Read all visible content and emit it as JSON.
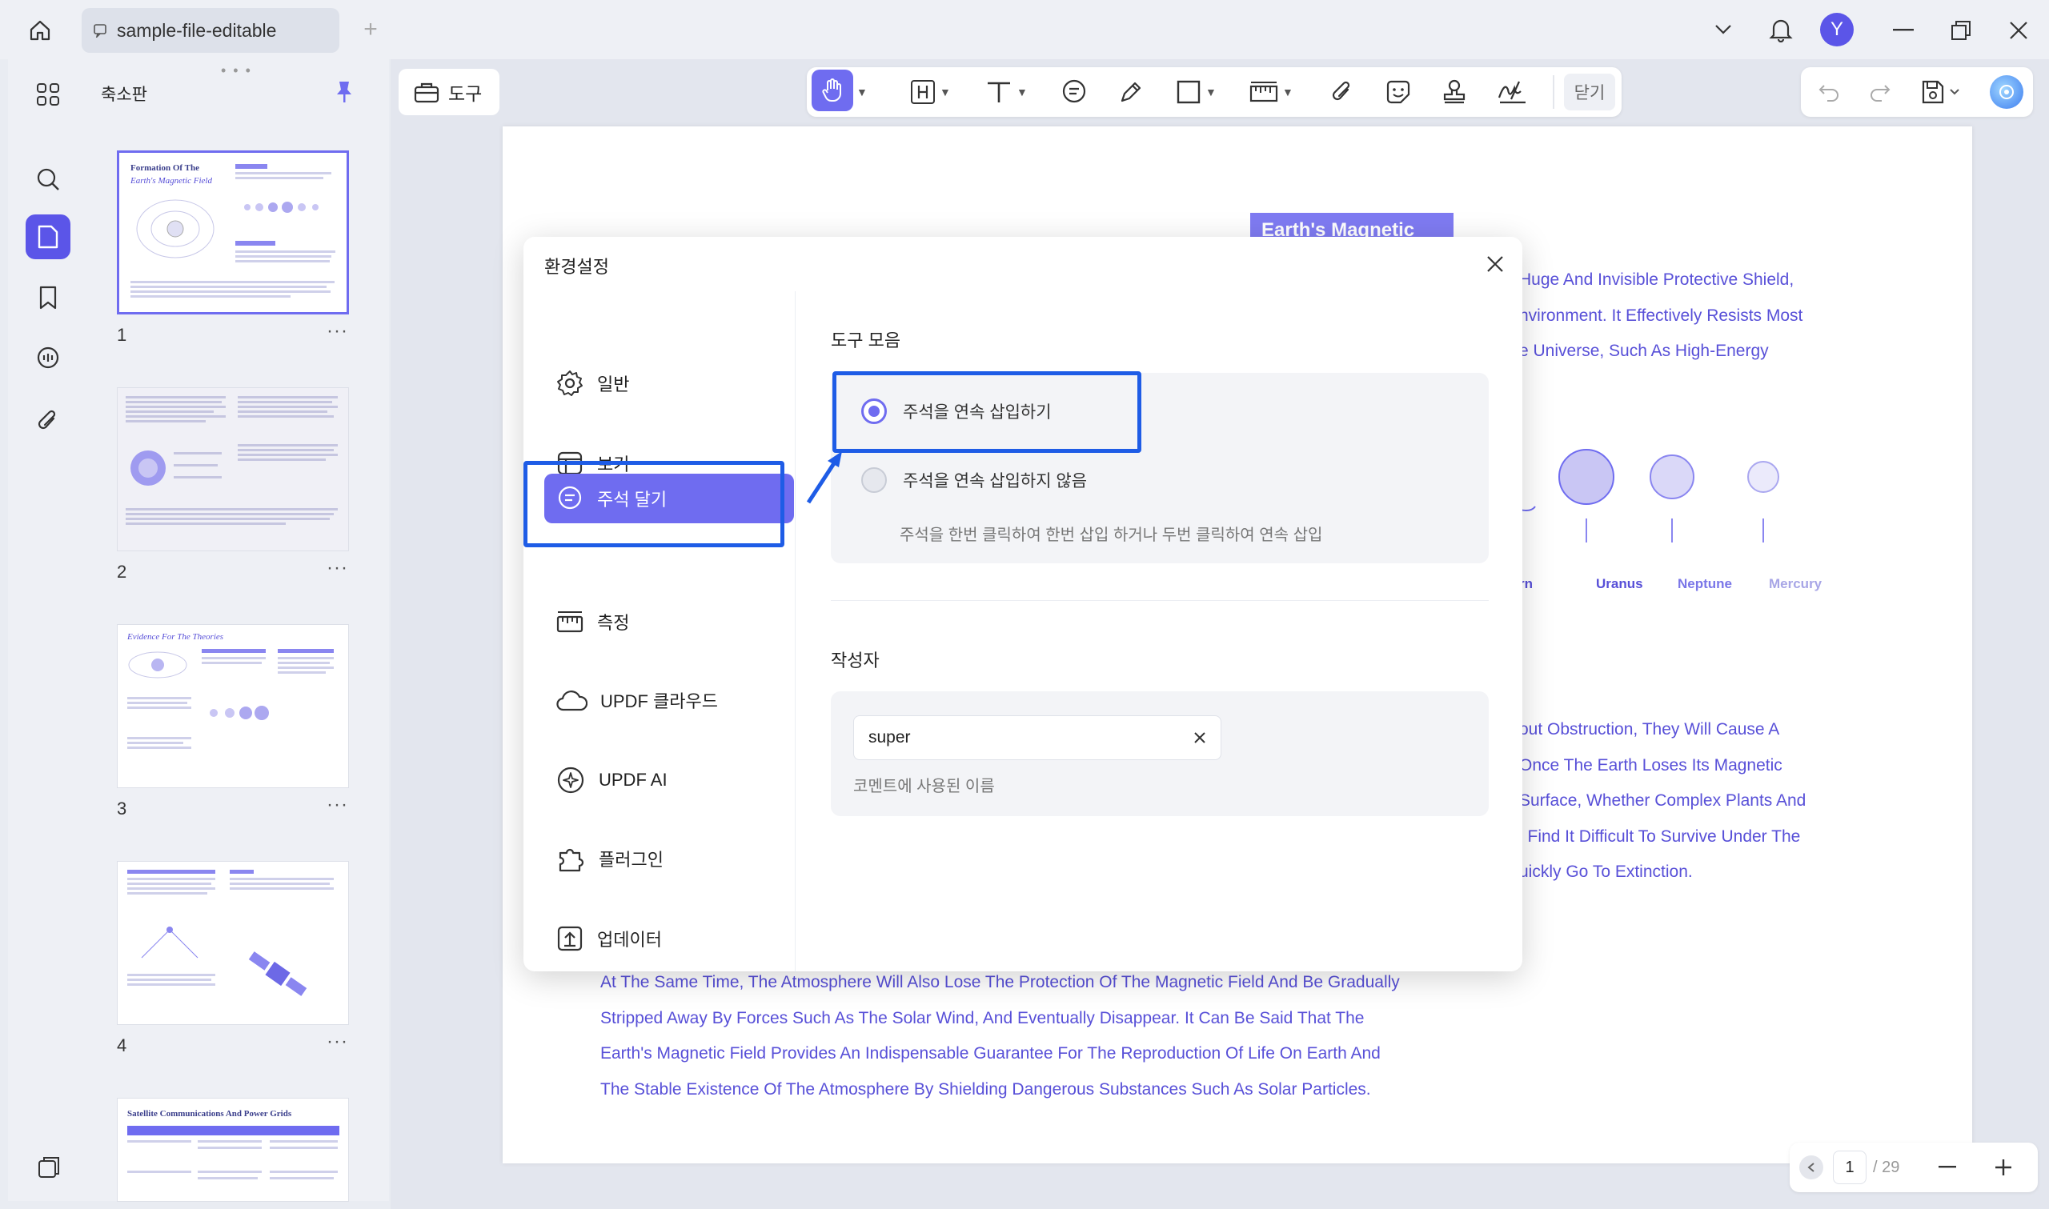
{
  "titlebar": {
    "tab_title": "sample-file-editable",
    "avatar_letter": "Y"
  },
  "sidebar": {
    "title": "축소판",
    "pages": [
      "1",
      "2",
      "3",
      "4"
    ]
  },
  "toolbar": {
    "tools_label": "도구",
    "close_label": "닫기"
  },
  "document": {
    "heading_partial": "Earth's Magnetic",
    "para1": [
      "Huge And Invisible Protective Shield,",
      "nvironment. It Effectively Resists Most",
      "e Universe, Such As High-Energy"
    ],
    "planets": [
      "rn",
      "Uranus",
      "Neptune",
      "Mercury"
    ],
    "para2": [
      "out Obstruction, They Will Cause A",
      "Once The Earth Loses Its Magnetic",
      "Surface, Whether Complex Plants And",
      "l Find It Difficult To Survive Under The",
      "uickly Go To Extinction."
    ],
    "para3": [
      "At The Same Time, The Atmosphere Will Also Lose The Protection Of The Magnetic Field And Be Gradually",
      "Stripped Away By Forces Such As The Solar Wind, And Eventually Disappear. It Can Be Said That The",
      "Earth's Magnetic Field Provides An Indispensable Guarantee For The Reproduction Of Life On Earth And",
      "The Stable Existence Of The Atmosphere By Shielding Dangerous Substances Such As Solar Particles."
    ]
  },
  "page_nav": {
    "current": "1",
    "total": "/ 29"
  },
  "dialog": {
    "title": "환경설정",
    "menu": [
      {
        "label": "일반",
        "icon": "gear-icon"
      },
      {
        "label": "보기",
        "icon": "layout-icon"
      },
      {
        "label": "주석 달기",
        "icon": "comment-icon"
      },
      {
        "label": "측정",
        "icon": "ruler-icon"
      },
      {
        "label": "UPDF 클라우드",
        "icon": "cloud-icon"
      },
      {
        "label": "UPDF AI",
        "icon": "ai-icon"
      },
      {
        "label": "플러그인",
        "icon": "puzzle-icon"
      },
      {
        "label": "업데이터",
        "icon": "update-icon"
      }
    ],
    "toolset": {
      "section_title": "도구 모음",
      "option_continuous": "주석을 연속 삽입하기",
      "option_single": "주석을 연속 삽입하지 않음",
      "hint": "주석을 한번 클릭하여 한번 삽입 하거나 두번 클릭하여 연속 삽입",
      "selected": "continuous"
    },
    "author": {
      "section_title": "작성자",
      "value": "super",
      "hint": "코멘트에 사용된 이름"
    }
  },
  "colors": {
    "accent": "#6f6cf0",
    "highlight": "#1e5ce6",
    "doc_text": "#5850d8"
  }
}
